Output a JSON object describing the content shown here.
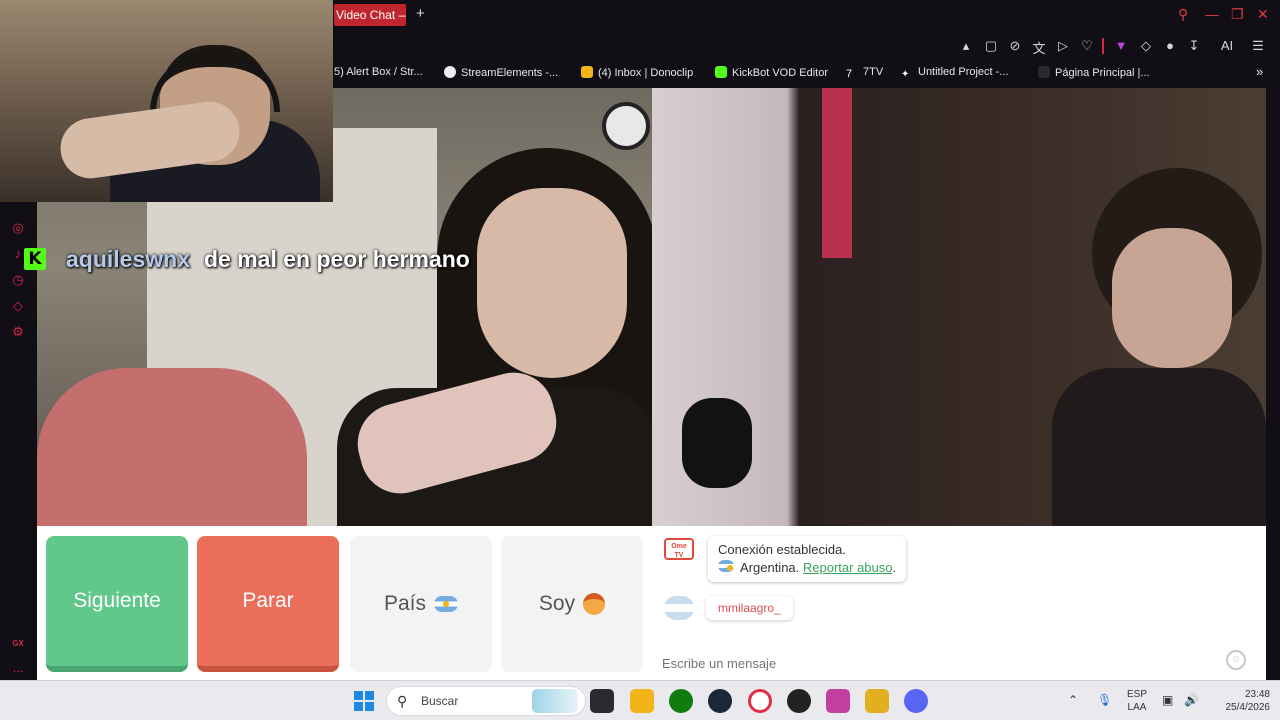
{
  "browser": {
    "tab_title": "Video Chat — ",
    "new_tab": "+",
    "bookmarks": [
      {
        "label": "5) Alert Box / Str...",
        "color": "#e8632e"
      },
      {
        "label": "StreamElements -...",
        "color": "#1a1a1a"
      },
      {
        "label": "(4) Inbox | Donoclip",
        "color": "#f2b418"
      },
      {
        "label": "KickBot VOD Editor",
        "color": "#53fc18"
      },
      {
        "label": "7TV",
        "color": "#ffffff"
      },
      {
        "label": "Untitled Project -...",
        "color": "#ffffff"
      },
      {
        "label": "Página Principal |...",
        "color": "#2a2a2a"
      }
    ],
    "ai_label": "AI"
  },
  "stream_overlay": {
    "chat_username": "aquileswnx",
    "chat_message": "de mal en peor hermano",
    "platform_icon": "kick-logo-icon"
  },
  "controls": {
    "next_label": "Siguiente",
    "stop_label": "Parar",
    "country_label": "País",
    "me_label": "Soy"
  },
  "chat": {
    "logo_text": "Ome TV",
    "system_message": "Conexión establecida.",
    "country": "Argentina.",
    "report_link": "Reportar abuso",
    "report_suffix": ".",
    "partner_name": "mmilaagro_",
    "input_placeholder": "Escribe un mensaje"
  },
  "sidebar": {
    "gx_label": "GX",
    "more_label": "..."
  },
  "taskbar": {
    "search_label": "Buscar",
    "lang_top": "ESP",
    "lang_bottom": "LAA",
    "time": "23:48",
    "date": "25/4/2026"
  },
  "colors": {
    "accent": "#d8264a",
    "next_button": "#5fc88a",
    "stop_button": "#ea6e5a",
    "link": "#3aa35a"
  }
}
